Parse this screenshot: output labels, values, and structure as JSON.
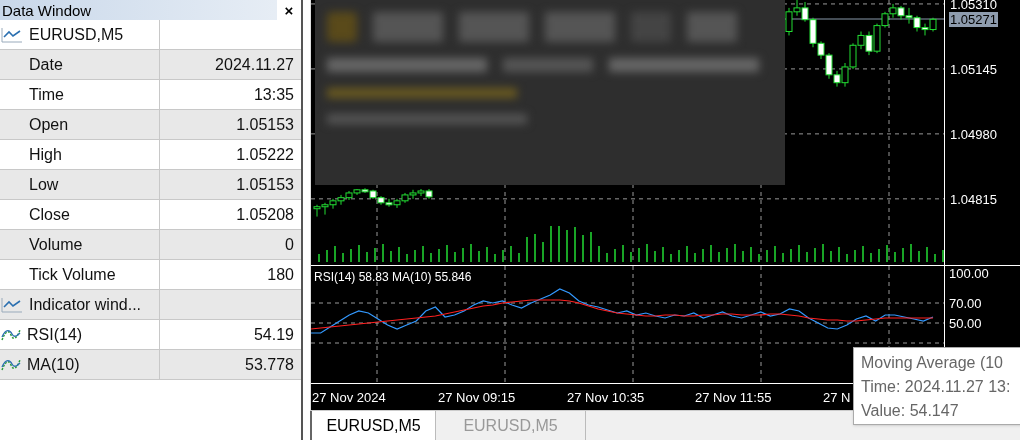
{
  "data_window": {
    "title": "Data Window",
    "close": "×",
    "rows": [
      {
        "kind": "symbol",
        "label": "EURUSD,M5"
      },
      {
        "kind": "field",
        "label": "Date",
        "value": "2024.11.27"
      },
      {
        "kind": "field",
        "label": "Time",
        "value": "13:35"
      },
      {
        "kind": "field",
        "label": "Open",
        "value": "1.05153"
      },
      {
        "kind": "field",
        "label": "High",
        "value": "1.05222"
      },
      {
        "kind": "field",
        "label": "Low",
        "value": "1.05153"
      },
      {
        "kind": "field",
        "label": "Close",
        "value": "1.05208"
      },
      {
        "kind": "field",
        "label": "Volume",
        "value": "0"
      },
      {
        "kind": "field",
        "label": "Tick Volume",
        "value": "180"
      },
      {
        "kind": "group",
        "label": "Indicator wind..."
      },
      {
        "kind": "indicator",
        "label": "RSI(14)",
        "value": "54.19"
      },
      {
        "kind": "indicator",
        "label": "MA(10)",
        "value": "53.778"
      }
    ]
  },
  "chart": {
    "current_price": "1.05271",
    "chart_data": {
      "type": "candlestick",
      "grid": true,
      "ylim": [
        1.04647,
        1.0532
      ],
      "yticks": [
        {
          "value": 1.0531,
          "label": "1.05310"
        },
        {
          "value": 1.05145,
          "label": "1.05145"
        },
        {
          "value": 1.0498,
          "label": "1.04980"
        },
        {
          "value": 1.04815,
          "label": "1.04815"
        }
      ],
      "ohlc": [
        [
          1.0479,
          1.048,
          1.0477,
          1.04795
        ],
        [
          1.04795,
          1.04805,
          1.04775,
          1.048
        ],
        [
          1.048,
          1.04815,
          1.0479,
          1.0481
        ],
        [
          1.0481,
          1.04825,
          1.048,
          1.04818
        ],
        [
          1.04818,
          1.04835,
          1.04812,
          1.0483
        ],
        [
          1.0483,
          1.0484,
          1.04825,
          1.04838
        ],
        [
          1.04838,
          1.04842,
          1.0483,
          1.04835
        ],
        [
          1.04835,
          1.04838,
          1.04815,
          1.04818
        ],
        [
          1.04818,
          1.04822,
          1.048,
          1.04805
        ],
        [
          1.04805,
          1.04815,
          1.04795,
          1.048
        ],
        [
          1.048,
          1.04815,
          1.04792,
          1.0481
        ],
        [
          1.0481,
          1.0483,
          1.04805,
          1.04825
        ],
        [
          1.04825,
          1.04838,
          1.04815,
          1.0483
        ],
        [
          1.0483,
          1.0484,
          1.04822,
          1.04835
        ],
        [
          1.04835,
          1.0484,
          1.04815,
          1.0482
        ],
        null,
        null,
        null,
        null,
        null,
        null,
        null,
        null,
        null,
        null,
        null,
        null,
        null,
        null,
        null,
        null,
        null,
        null,
        null,
        null,
        null,
        null,
        null,
        null,
        null,
        null,
        null,
        null,
        null,
        null,
        null,
        null,
        null,
        null,
        null,
        null,
        null,
        null,
        null,
        null,
        null,
        null,
        null,
        null,
        [
          1.0524,
          1.053,
          1.0523,
          1.0529
        ],
        [
          1.0529,
          1.0532,
          1.0528,
          1.053
        ],
        [
          1.053,
          1.05315,
          1.05265,
          1.0527
        ],
        [
          1.0527,
          1.05275,
          1.052,
          1.0521
        ],
        [
          1.0521,
          1.05215,
          1.0517,
          1.0518
        ],
        [
          1.0518,
          1.05185,
          1.0512,
          1.0513
        ],
        [
          1.0513,
          1.0514,
          1.051,
          1.0511
        ],
        [
          1.0511,
          1.0516,
          1.051,
          1.0515
        ],
        [
          1.0515,
          1.0521,
          1.05145,
          1.05205
        ],
        [
          1.05205,
          1.0524,
          1.05195,
          1.0523
        ],
        [
          1.0523,
          1.0524,
          1.0518,
          1.0519
        ],
        [
          1.0519,
          1.0526,
          1.05185,
          1.05255
        ],
        [
          1.05255,
          1.0529,
          1.0525,
          1.05285
        ],
        [
          1.05285,
          1.0531,
          1.05275,
          1.053
        ],
        [
          1.053,
          1.05305,
          1.0527,
          1.0528
        ],
        [
          1.0528,
          1.053,
          1.0526,
          1.05275
        ],
        [
          1.05275,
          1.0528,
          1.0524,
          1.0525
        ],
        [
          1.0525,
          1.0526,
          1.0523,
          1.05245
        ],
        [
          1.05245,
          1.05275,
          1.0524,
          1.05271
        ]
      ]
    },
    "indicator": {
      "readings": [
        "58.83",
        "55.846"
      ],
      "chart_data": {
        "type": "line",
        "grid": true,
        "ylim": [
          -10,
          100
        ],
        "yticks": [
          {
            "value": 100,
            "label": "100.00"
          },
          {
            "value": 70,
            "label": "70.00"
          },
          {
            "value": 50,
            "label": "50.00"
          }
        ],
        "series": [
          {
            "name": "RSI(14)",
            "color": "#3399ff",
            "values": [
              40,
              40,
              46,
              52,
              58,
              62,
              60,
              54,
              48,
              44,
              48,
              52,
              62,
              66,
              56,
              58,
              62,
              68,
              72,
              70,
              72,
              68,
              65,
              70,
              74,
              78,
              84,
              80,
              72,
              68,
              66,
              63,
              60,
              62,
              58,
              60,
              57,
              55,
              58,
              57,
              60,
              55,
              58,
              61,
              57,
              55,
              58,
              61,
              57,
              59,
              64,
              62,
              55,
              50,
              45,
              44,
              48,
              54,
              57,
              52,
              58,
              58,
              56,
              54,
              52,
              56
            ]
          },
          {
            "name": "MA(10)",
            "color": "#ff2020",
            "values": [
              44,
              45,
              46,
              47,
              48,
              49,
              50,
              51,
              52,
              53,
              54,
              55,
              56,
              57,
              59,
              61,
              63,
              65,
              67,
              68,
              70,
              71,
              72,
              73,
              73,
              73,
              73,
              72,
              70,
              67,
              64,
              62,
              60,
              59,
              58,
              57,
              57,
              58,
              58,
              57,
              57,
              58,
              58,
              59,
              59,
              58,
              58,
              58,
              59,
              59,
              58,
              57,
              55,
              54,
              53,
              53,
              52,
              52,
              53,
              54,
              55,
              55,
              55,
              55,
              55,
              55
            ]
          }
        ]
      }
    },
    "time_labels": [
      "27 Nov 2024",
      "27 Nov 09:15",
      "27 Nov 10:35",
      "27 Nov 11:55",
      "27 N"
    ],
    "tooltip": [
      "Moving Average (10",
      "Time: 2024.11.27 13:",
      "Value: 54.147"
    ]
  },
  "tabs": [
    {
      "label": "EURUSD,M5",
      "selected": true
    },
    {
      "label": "EURUSD,M5",
      "selected": false
    }
  ]
}
